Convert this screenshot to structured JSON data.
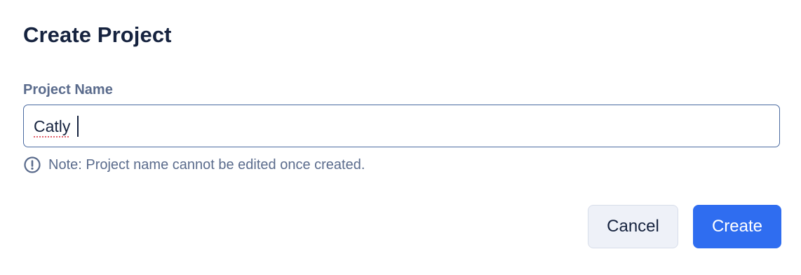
{
  "dialog": {
    "title": "Create Project",
    "field": {
      "label": "Project Name",
      "value": "Catly"
    },
    "note": {
      "icon": "info-circle-icon",
      "text": "Note: Project name cannot be edited once created."
    },
    "buttons": {
      "cancel_label": "Cancel",
      "create_label": "Create"
    }
  },
  "colors": {
    "title": "#16233f",
    "muted_text": "#5a6b8c",
    "input_border": "#4a6aa0",
    "primary": "#2f6df0",
    "secondary_bg": "#eef1f8",
    "spellcheck_underline": "#e0606a"
  }
}
